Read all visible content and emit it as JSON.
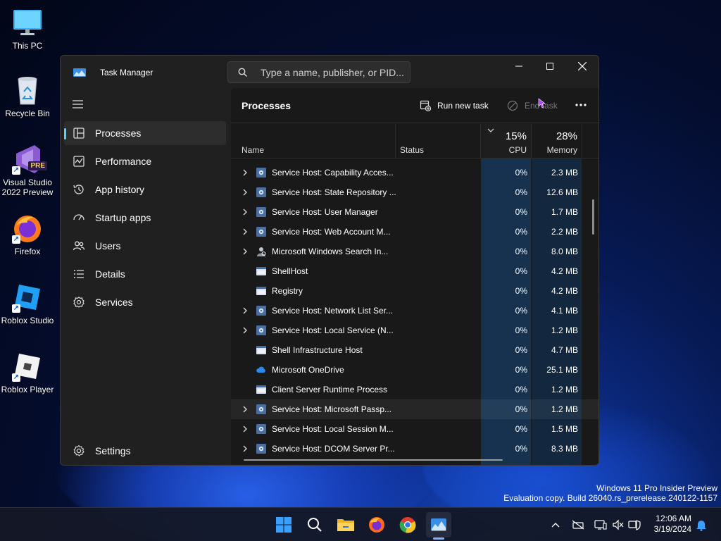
{
  "desktop": {
    "icons": [
      {
        "label": "This PC",
        "icon": "monitor-icon"
      },
      {
        "label": "Recycle Bin",
        "icon": "recycle-bin-icon"
      },
      {
        "label": "Visual Studio 2022 Preview",
        "icon": "visual-studio-icon",
        "badge": "PRE"
      },
      {
        "label": "Firefox",
        "icon": "firefox-icon"
      },
      {
        "label": "Roblox Studio",
        "icon": "roblox-studio-icon"
      },
      {
        "label": "Roblox Player",
        "icon": "roblox-player-icon"
      }
    ],
    "watermark": {
      "line1": "Windows 11 Pro Insider Preview",
      "line2": "Evaluation copy. Build 26040.rs_prerelease.240122-1157"
    }
  },
  "window": {
    "title": "Task Manager",
    "search_placeholder": "Type a name, publisher, or PID..."
  },
  "sidebar": {
    "items": [
      {
        "label": "Processes",
        "icon": "processes-icon",
        "active": true
      },
      {
        "label": "Performance",
        "icon": "performance-icon"
      },
      {
        "label": "App history",
        "icon": "app-history-icon"
      },
      {
        "label": "Startup apps",
        "icon": "startup-apps-icon"
      },
      {
        "label": "Users",
        "icon": "users-icon"
      },
      {
        "label": "Details",
        "icon": "details-icon"
      },
      {
        "label": "Services",
        "icon": "services-icon"
      }
    ],
    "settings_label": "Settings"
  },
  "main": {
    "title": "Processes",
    "run_new_task": "Run new task",
    "end_task": "End task",
    "columns": {
      "name": "Name",
      "status": "Status",
      "cpu_pct": "15%",
      "cpu": "CPU",
      "mem_pct": "28%",
      "memory": "Memory"
    },
    "rows": [
      {
        "name": "Service Host: Capability Acces...",
        "cpu": "0%",
        "memory": "2.3 MB",
        "expandable": true,
        "icon": "gear"
      },
      {
        "name": "Service Host: State Repository ...",
        "cpu": "0%",
        "memory": "12.6 MB",
        "expandable": true,
        "icon": "gear"
      },
      {
        "name": "Service Host: User Manager",
        "cpu": "0%",
        "memory": "1.7 MB",
        "expandable": true,
        "icon": "gear"
      },
      {
        "name": "Service Host: Web Account M...",
        "cpu": "0%",
        "memory": "2.2 MB",
        "expandable": true,
        "icon": "gear"
      },
      {
        "name": "Microsoft Windows Search In...",
        "cpu": "0%",
        "memory": "8.0 MB",
        "expandable": true,
        "icon": "search-person"
      },
      {
        "name": "ShellHost",
        "cpu": "0%",
        "memory": "4.2 MB",
        "expandable": false,
        "icon": "window"
      },
      {
        "name": "Registry",
        "cpu": "0%",
        "memory": "4.2 MB",
        "expandable": false,
        "icon": "window"
      },
      {
        "name": "Service Host: Network List Ser...",
        "cpu": "0%",
        "memory": "4.1 MB",
        "expandable": true,
        "icon": "gear"
      },
      {
        "name": "Service Host: Local Service (N...",
        "cpu": "0%",
        "memory": "1.2 MB",
        "expandable": true,
        "icon": "gear"
      },
      {
        "name": "Shell Infrastructure Host",
        "cpu": "0%",
        "memory": "4.7 MB",
        "expandable": false,
        "icon": "window"
      },
      {
        "name": "Microsoft OneDrive",
        "cpu": "0%",
        "memory": "25.1 MB",
        "expandable": false,
        "icon": "cloud"
      },
      {
        "name": "Client Server Runtime Process",
        "cpu": "0%",
        "memory": "1.2 MB",
        "expandable": false,
        "icon": "window"
      },
      {
        "name": "Service Host: Microsoft Passp...",
        "cpu": "0%",
        "memory": "1.2 MB",
        "expandable": true,
        "icon": "gear",
        "highlight": true
      },
      {
        "name": "Service Host: Local Session M...",
        "cpu": "0%",
        "memory": "1.5 MB",
        "expandable": true,
        "icon": "gear"
      },
      {
        "name": "Service Host: DCOM Server Pr...",
        "cpu": "0%",
        "memory": "8.3 MB",
        "expandable": true,
        "icon": "gear"
      }
    ]
  },
  "taskbar": {
    "apps": [
      "start-icon",
      "search-icon",
      "file-explorer-icon",
      "firefox-icon",
      "chrome-icon",
      "task-manager-icon"
    ],
    "time": "12:06 AM",
    "date": "3/19/2024"
  },
  "colors": {
    "accent": "#60cdff",
    "cpu_column": "#16324f",
    "memory_column": "#13283e",
    "window_bg": "#202020"
  }
}
